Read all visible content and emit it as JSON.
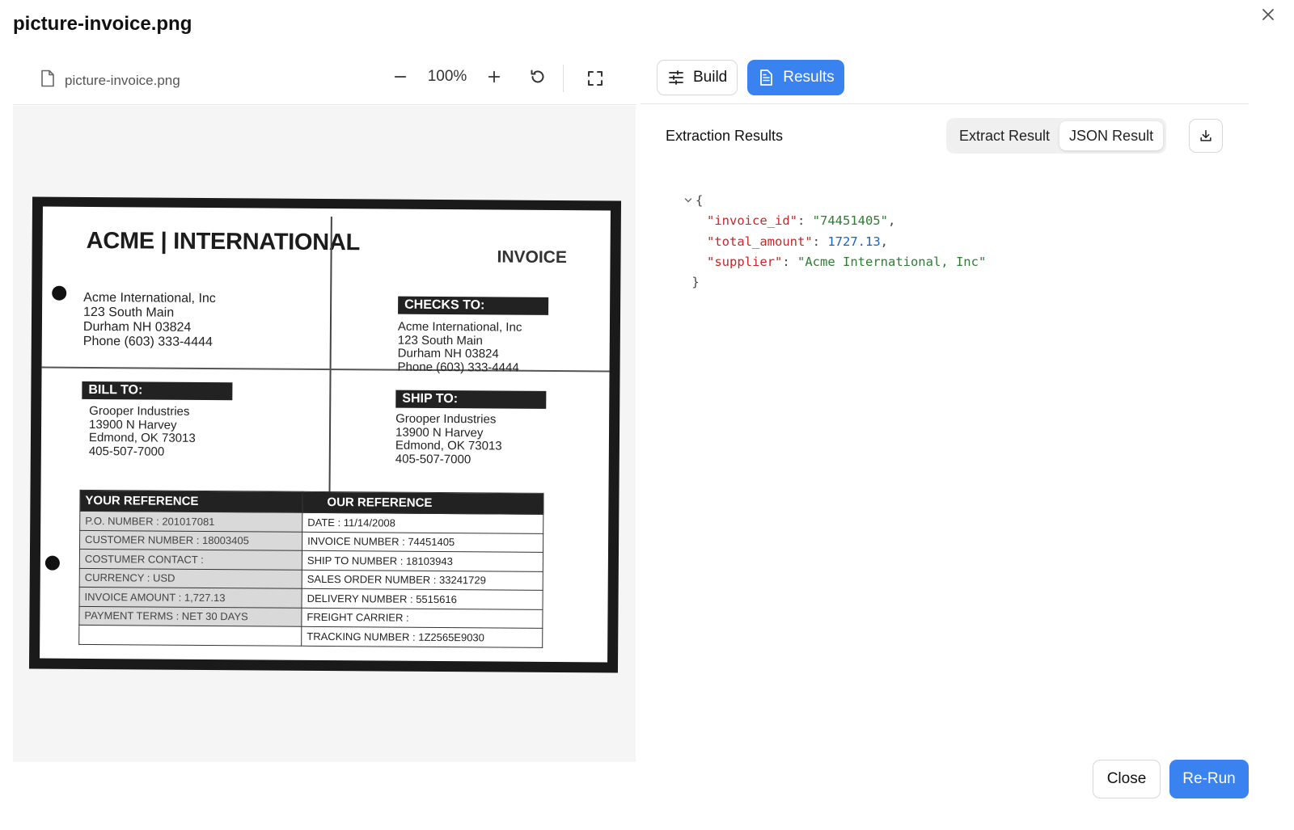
{
  "dialog": {
    "title": "picture-invoice.png"
  },
  "viewer": {
    "file_name": "picture-invoice.png",
    "zoom": "100%"
  },
  "invoice_image": {
    "brand": "ACME | INTERNATIONAL",
    "title": "INVOICE",
    "from_address": [
      "Acme International, Inc",
      "123 South Main",
      "Durham NH  03824",
      "Phone  (603)  333-4444"
    ],
    "checks_to_label": "CHECKS TO:",
    "checks_to_address": [
      "Acme International, Inc",
      "123 South Main",
      "Durham NH  03824",
      "Phone  (603)  333-4444"
    ],
    "bill_to_label": "BILL TO:",
    "bill_to_address": [
      "Grooper Industries",
      "13900 N Harvey",
      "Edmond, OK  73013",
      "405-507-7000"
    ],
    "ship_to_label": "SHIP TO:",
    "ship_to_address": [
      "Grooper Industries",
      "13900 N Harvey",
      "Edmond, OK  73013",
      "405-507-7000"
    ],
    "your_reference_label": "YOUR REFERENCE",
    "our_reference_label": "OUR REFERENCE",
    "rows": [
      {
        "left": "P.O. NUMBER      : 201017081",
        "right": "DATE                 : 11/14/2008"
      },
      {
        "left": "CUSTOMER NUMBER : 18003405",
        "right": "INVOICE NUMBER     : 74451405"
      },
      {
        "left": "COSTUMER CONTACT :",
        "right": "SHIP TO NUMBER     : 18103943"
      },
      {
        "left": "CURRENCY         : USD",
        "right": "SALES ORDER NUMBER : 33241729"
      },
      {
        "left": "INVOICE AMOUNT   : 1,727.13",
        "right": "DELIVERY NUMBER    : 5515616"
      },
      {
        "left": "PAYMENT TERMS    : NET 30 DAYS",
        "right": "FREIGHT CARRIER    :"
      },
      {
        "left": "",
        "right": "TRACKING NUMBER    : 1Z2565E9030"
      }
    ]
  },
  "tabs": {
    "build": "Build",
    "results": "Results"
  },
  "results": {
    "section_title": "Extraction Results",
    "segments": {
      "extract": "Extract Result",
      "json": "JSON Result"
    },
    "json_open": "{",
    "json_close": "}",
    "fields": [
      {
        "key": "\"invoice_id\"",
        "value": "\"74451405\"",
        "type": "str",
        "comma": ","
      },
      {
        "key": "\"total_amount\"",
        "value": "1727.13",
        "type": "num",
        "comma": ","
      },
      {
        "key": "\"supplier\"",
        "value": "\"Acme International, Inc\"",
        "type": "str",
        "comma": ""
      }
    ]
  },
  "footer": {
    "close": "Close",
    "rerun": "Re-Run"
  },
  "colors": {
    "accent": "#3a82f0",
    "json_key": "#c62828",
    "json_string": "#2e7d32",
    "json_number": "#1565c0"
  }
}
